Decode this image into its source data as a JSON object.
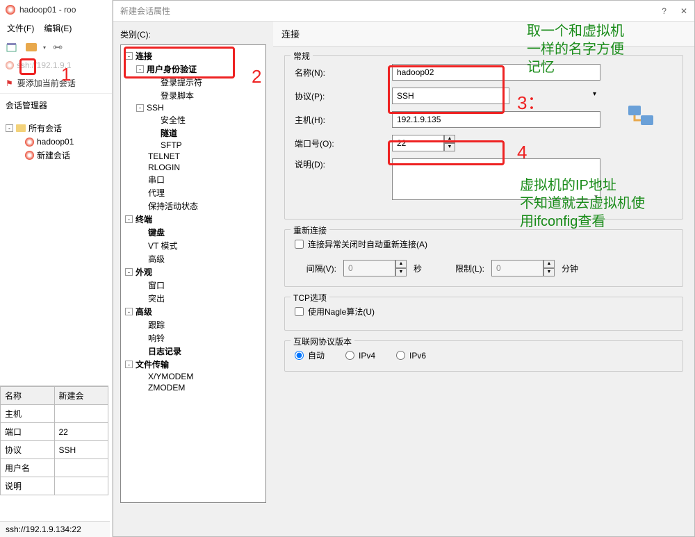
{
  "main_window": {
    "title": "hadoop01 - roo",
    "menu": {
      "file": "文件(F)",
      "edit": "编辑(E)"
    },
    "address": "ssh://192.1.9.1",
    "add_fav": "要添加当前会话",
    "session_mgr_label": "会话管理器",
    "tree": {
      "root": "所有会话",
      "items": [
        "hadoop01",
        "新建会话"
      ]
    },
    "props": {
      "headers": {
        "name": "名称",
        "value": "新建会"
      },
      "rows": [
        {
          "k": "主机",
          "v": ""
        },
        {
          "k": "端口",
          "v": "22"
        },
        {
          "k": "协议",
          "v": "SSH"
        },
        {
          "k": "用户名",
          "v": ""
        },
        {
          "k": "说明",
          "v": ""
        }
      ]
    },
    "statusbar": "ssh://192.1.9.134:22"
  },
  "dialog": {
    "title": "新建会话属性",
    "help": "?",
    "close": "✕",
    "category_label": "类别(C):",
    "tree": {
      "connection": "连接",
      "user_auth": "用户身份验证",
      "login_prompt": "登录提示符",
      "login_script": "登录脚本",
      "ssh": "SSH",
      "security": "安全性",
      "tunnel": "隧道",
      "sftp": "SFTP",
      "telnet": "TELNET",
      "rlogin": "RLOGIN",
      "serial": "串口",
      "proxy": "代理",
      "keep_active": "保持活动状态",
      "terminal": "终端",
      "keyboard": "键盘",
      "vt_mode": "VT 模式",
      "advanced_term": "高级",
      "appearance": "外观",
      "window": "窗口",
      "highlight": "突出",
      "advanced": "高级",
      "trace": "跟踪",
      "bell": "响铃",
      "logging": "日志记录",
      "file_transfer": "文件传输",
      "xymodem": "X/YMODEM",
      "zmodem": "ZMODEM"
    },
    "section_header": "连接",
    "general": {
      "title": "常规",
      "name_label": "名称(N):",
      "name_value": "hadoop02",
      "protocol_label": "协议(P):",
      "protocol_value": "SSH",
      "host_label": "主机(H):",
      "host_value": "192.1.9.135",
      "port_label": "端口号(O):",
      "port_value": "22",
      "desc_label": "说明(D):",
      "desc_value": ""
    },
    "reconnect": {
      "title": "重新连接",
      "checkbox_label": "连接异常关闭时自动重新连接(A)",
      "interval_label": "间隔(V):",
      "interval_value": "0",
      "interval_unit": "秒",
      "limit_label": "限制(L):",
      "limit_value": "0",
      "limit_unit": "分钟"
    },
    "tcp": {
      "title": "TCP选项",
      "nagle_label": "使用Nagle算法(U)"
    },
    "ipver": {
      "title": "互联网协议版本",
      "auto": "自动",
      "ipv4": "IPv4",
      "ipv6": "IPv6"
    }
  },
  "annotations": {
    "a1": "1",
    "a2": "2",
    "a3": "3：",
    "a4": "4",
    "g1": "取一个和虚拟机\n一样的名字方便\n记忆",
    "g2": "虚拟机的IP地址\n不知道就去虚拟机使\n用ifconfig查看"
  }
}
